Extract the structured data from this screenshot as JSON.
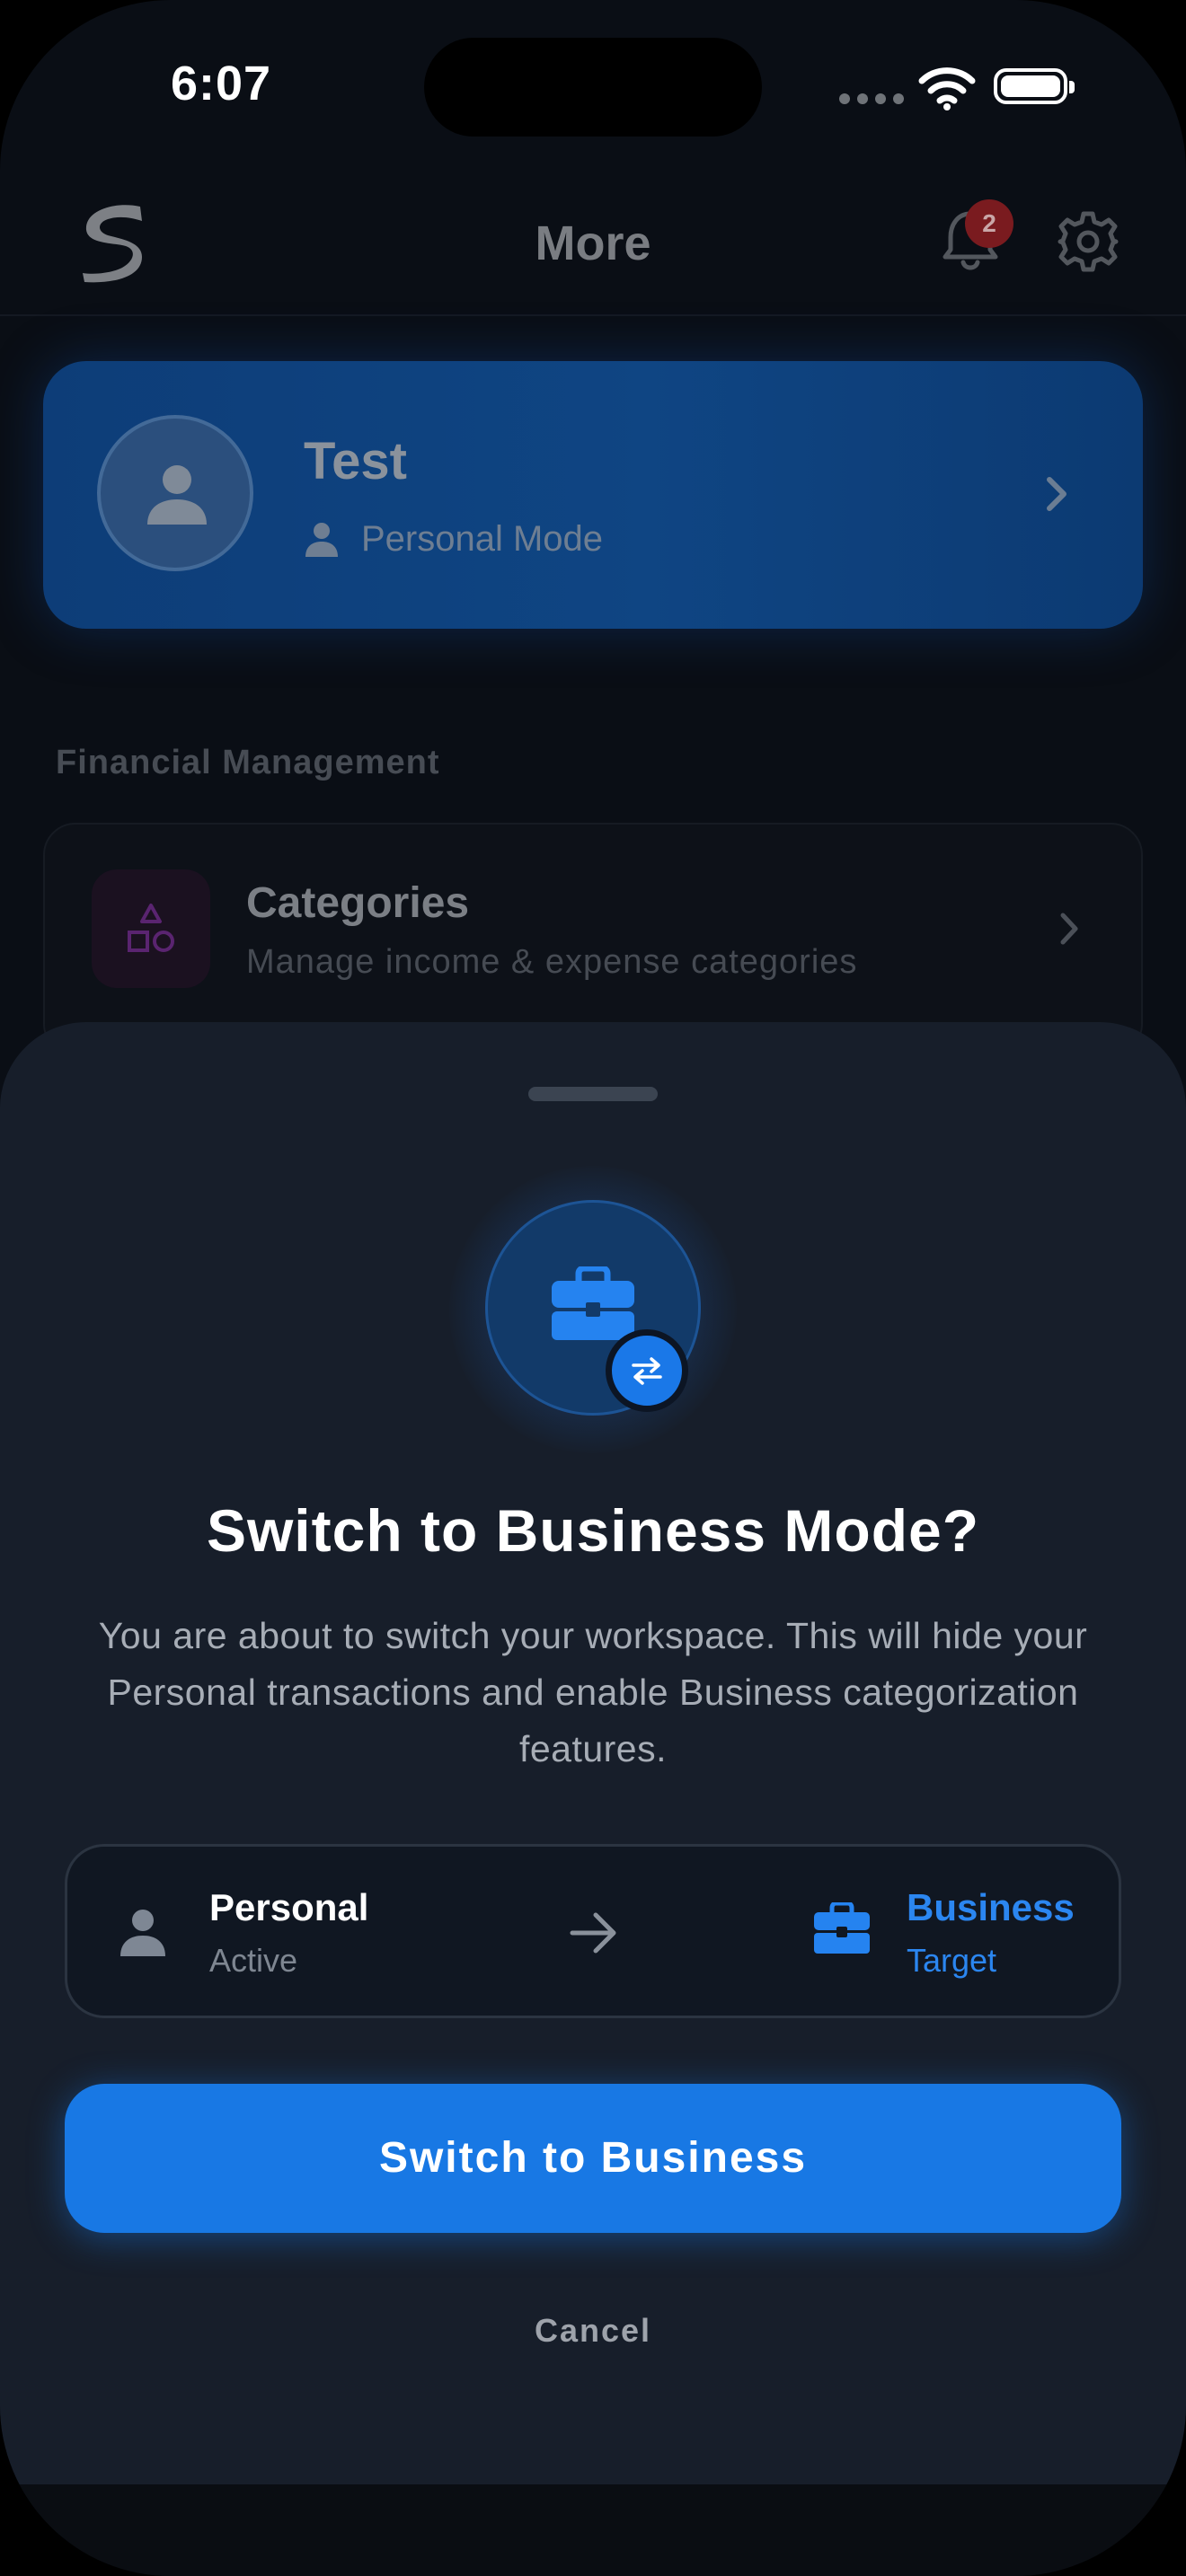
{
  "status_bar": {
    "time": "6:07"
  },
  "header": {
    "title": "More",
    "notification_count": "2"
  },
  "profile": {
    "name": "Test",
    "mode": "Personal Mode"
  },
  "sections": [
    {
      "title": "Financial Management",
      "items": [
        {
          "title": "Categories",
          "subtitle": "Manage income & expense categories"
        }
      ]
    }
  ],
  "sheet": {
    "title": "Switch to Business Mode?",
    "description": "You are about to switch your workspace. This will hide your Personal transactions and enable Business categorization features.",
    "from": {
      "label": "Personal",
      "status": "Active"
    },
    "to": {
      "label": "Business",
      "status": "Target"
    },
    "confirm_label": "Switch to Business",
    "cancel_label": "Cancel"
  },
  "colors": {
    "accent": "#1878E4",
    "sheet_background": "#171E2A",
    "screen_background": "#0A0E15",
    "badge": "#7A1B1F"
  },
  "icons": {
    "logo": "app-logo",
    "notifications": "bell-icon",
    "settings": "gear-icon",
    "profile": "person-icon",
    "categories": "shapes-icon",
    "business": "briefcase-icon",
    "swap": "swap-arrows-icon",
    "direction": "arrow-right-icon"
  }
}
